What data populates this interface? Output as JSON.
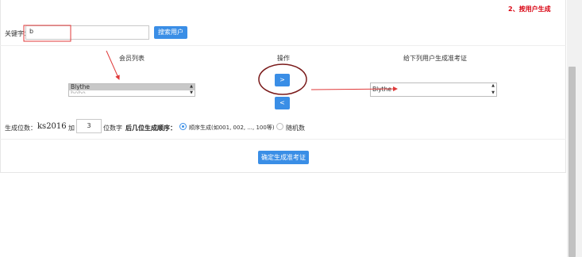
{
  "header": {
    "step_title": "2、按用户生成"
  },
  "search": {
    "keyword_label": "关键字：",
    "keyword_value": "b",
    "search_button": "搜索用户"
  },
  "columns": {
    "member_list": "会员列表",
    "operation": "操作",
    "target_list": "给下列用户生成准考证"
  },
  "member_list": {
    "options": [
      "Blythe",
      "bobo"
    ]
  },
  "target_list": {
    "options": [
      "Blythe"
    ]
  },
  "move_buttons": {
    "add": ">",
    "remove": "<"
  },
  "generate": {
    "digits_label": "生成位数：",
    "prefix": "ks2016",
    "plus_label": "加",
    "digit_count": "3",
    "digit_suffix": "位数字",
    "order_label": "后几位生成顺序：",
    "order_sequential": "顺序生成(如001, 002, ..., 100等)",
    "order_random": "随机数"
  },
  "confirm_button": "确定生成准考证",
  "annotation_colors": {
    "highlight": "#e03a3a",
    "circle": "#7a1a1a"
  }
}
